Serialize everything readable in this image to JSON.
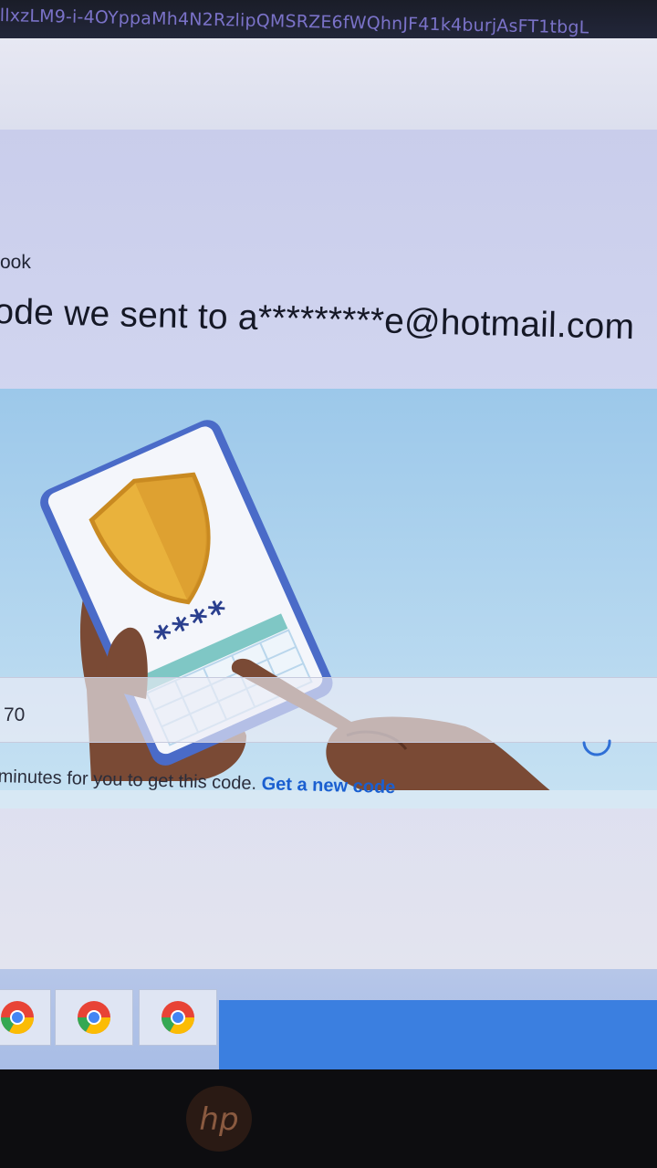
{
  "browser": {
    "url_fragment": "llxzLM9-i-4OYppaMh4N2RzlipQMSRZE6fWQhnJF41k4burjAsFT1tbgL"
  },
  "page": {
    "brand": "ook",
    "headline": "ode we sent to a*********e@hotmail.com",
    "illustration": {
      "masked_code": "****"
    },
    "code_input": {
      "value": "70"
    },
    "help": {
      "text": "minutes for you to get this code.",
      "link_label": "Get a new code"
    }
  },
  "taskbar": {
    "items": [
      "chrome-app-1",
      "chrome-app-2",
      "chrome-app-3"
    ]
  },
  "device": {
    "logo": "hp"
  },
  "colors": {
    "link": "#1a5fd0",
    "shield": "#e9b23c",
    "phone_frame": "#4a6bc8",
    "skin": "#7a4a35",
    "spinner": "#2f6fd6"
  }
}
